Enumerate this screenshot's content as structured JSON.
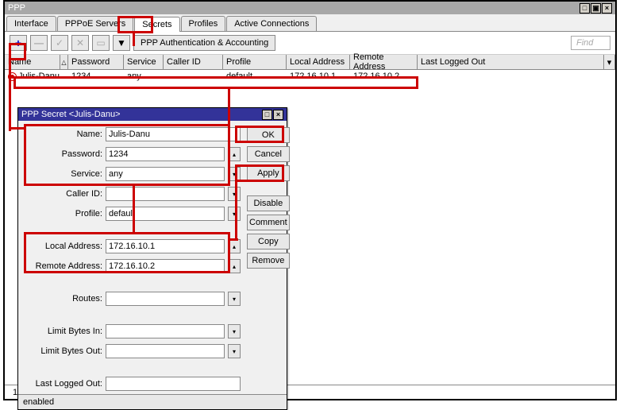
{
  "main": {
    "title": "PPP",
    "tabs": [
      "Interface",
      "PPPoE Servers",
      "Secrets",
      "Profiles",
      "Active Connections"
    ],
    "active_tab": 2,
    "toolbar_button": "PPP Authentication & Accounting",
    "find_placeholder": "Find",
    "columns": [
      "Name",
      "Password",
      "Service",
      "Caller ID",
      "Profile",
      "Local Address",
      "Remote Address",
      "Last Logged Out"
    ],
    "row": {
      "name": "Julis-Danu",
      "password": "1234",
      "service": "any",
      "caller_id": "",
      "profile": "default",
      "local_addr": "172.16.10.1",
      "remote_addr": "172.16.10.2"
    },
    "status_count": "1 i"
  },
  "dialog": {
    "title": "PPP Secret <Julis-Danu>",
    "fields": {
      "name_label": "Name:",
      "name": "Julis-Danu",
      "password_label": "Password:",
      "password": "1234",
      "service_label": "Service:",
      "service": "any",
      "caller_id_label": "Caller ID:",
      "caller_id": "",
      "profile_label": "Profile:",
      "profile": "default",
      "local_addr_label": "Local Address:",
      "local_addr": "172.16.10.1",
      "remote_addr_label": "Remote Address:",
      "remote_addr": "172.16.10.2",
      "routes_label": "Routes:",
      "routes": "",
      "limit_in_label": "Limit Bytes In:",
      "limit_in": "",
      "limit_out_label": "Limit Bytes Out:",
      "limit_out": "",
      "last_logged_label": "Last Logged Out:",
      "last_logged": ""
    },
    "buttons": {
      "ok": "OK",
      "cancel": "Cancel",
      "apply": "Apply",
      "disable": "Disable",
      "comment": "Comment",
      "copy": "Copy",
      "remove": "Remove"
    },
    "status": "enabled"
  }
}
